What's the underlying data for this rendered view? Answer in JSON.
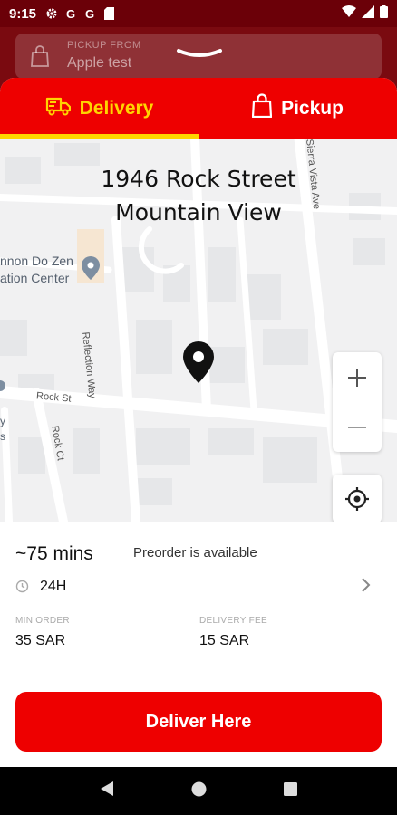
{
  "status_bar": {
    "time": "9:15",
    "icons": [
      "gear-icon",
      "google-icon",
      "google-icon",
      "sd-card-icon"
    ],
    "right_icons": [
      "wifi-icon",
      "signal-icon",
      "battery-icon"
    ],
    "g1": "G",
    "g2": "G"
  },
  "header": {
    "pickup_label": "PICKUP FROM",
    "pickup_value": "Apple test"
  },
  "tabs": [
    {
      "label": "Delivery",
      "icon": "delivery-truck-icon",
      "active": true
    },
    {
      "label": "Pickup",
      "icon": "shopping-bag-icon",
      "active": false
    }
  ],
  "map": {
    "address_line1": "1946 Rock Street",
    "address_line2": "Mountain View",
    "poi_line1": "nnon Do Zen",
    "poi_line2": "ation Center",
    "streets": [
      "Reflection Way",
      "Rock St",
      "Rock Ct",
      "Sierra Vista Ave"
    ],
    "edge_text_1": "y",
    "edge_text_2": "s"
  },
  "info": {
    "eta": "~75 mins",
    "preorder": "Preorder is available",
    "hours": "24H",
    "min_order_label": "MIN ORDER",
    "min_order_value": "35 SAR",
    "delivery_fee_label": "DELIVERY FEE",
    "delivery_fee_value": "15 SAR"
  },
  "actions": {
    "deliver_label": "Deliver Here"
  },
  "colors": {
    "primary": "#ee0000",
    "accent": "#ffd400",
    "header_dim": "#7a0a10"
  }
}
